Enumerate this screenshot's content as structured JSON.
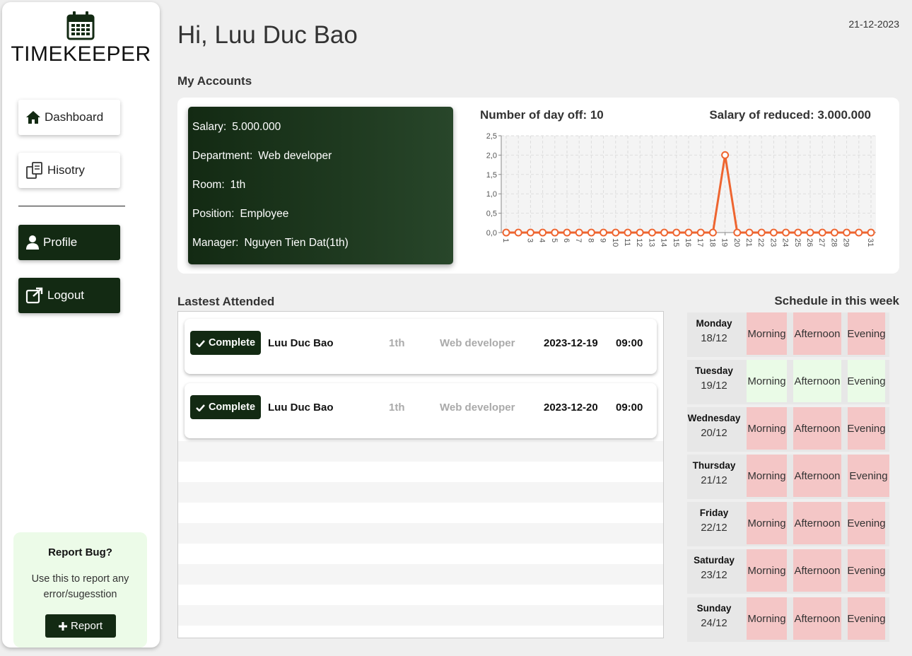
{
  "brand": {
    "title": "TIMEKEEPER",
    "icon": "calendar-icon"
  },
  "nav": {
    "dashboard": "Dashboard",
    "history": "Hisotry",
    "profile": "Profile",
    "logout": "Logout"
  },
  "report": {
    "title": "Report Bug?",
    "description": "Use this to report any error/sugesstion",
    "button": "Report"
  },
  "header": {
    "greeting": "Hi, Luu Duc Bao",
    "date": "21-12-2023"
  },
  "accounts": {
    "section_title": "My Accounts",
    "fields": [
      {
        "label": "Salary:",
        "value": "5.000.000"
      },
      {
        "label": "Department:",
        "value": "Web developer"
      },
      {
        "label": "Room:",
        "value": "1th"
      },
      {
        "label": "Position:",
        "value": "Employee"
      },
      {
        "label": "Manager:",
        "value": "Nguyen Tien Dat(1th)"
      }
    ],
    "day_off": "Number of day off: 10",
    "salary_reduced": "Salary of reduced: 3.000.000"
  },
  "chart_data": {
    "type": "line",
    "x": [
      1,
      2,
      3,
      4,
      5,
      6,
      7,
      8,
      9,
      10,
      11,
      12,
      13,
      14,
      15,
      16,
      17,
      18,
      19,
      20,
      21,
      22,
      23,
      24,
      25,
      26,
      27,
      28,
      29,
      30,
      31
    ],
    "x_tick_labels": [
      "1",
      "3",
      "4",
      "5",
      "6",
      "7",
      "8",
      "9",
      "10",
      "11",
      "12",
      "13",
      "14",
      "15",
      "16",
      "17",
      "18",
      "19",
      "20",
      "21",
      "22",
      "23",
      "24",
      "25",
      "26",
      "27",
      "28",
      "29",
      "31"
    ],
    "series": [
      {
        "values": [
          0,
          0,
          0,
          0,
          0,
          0,
          0,
          0,
          0,
          0,
          0,
          0,
          0,
          0,
          0,
          0,
          0,
          0,
          2,
          0,
          0,
          0,
          0,
          0,
          0,
          0,
          0,
          0,
          0,
          0,
          0
        ],
        "color": "#ee6530"
      }
    ],
    "y_ticks": [
      "0,0",
      "0,5",
      "1,0",
      "1,5",
      "2,0",
      "2,5"
    ],
    "ylim": [
      0,
      2.5
    ],
    "grid": true
  },
  "attended": {
    "section_title": "Lastest Attended",
    "rows": [
      {
        "status": "Complete",
        "name": "Luu Duc Bao",
        "room": "1th",
        "department": "Web developer",
        "date": "2023-12-19",
        "time": "09:00"
      },
      {
        "status": "Complete",
        "name": "Luu Duc Bao",
        "room": "1th",
        "department": "Web developer",
        "date": "2023-12-20",
        "time": "09:00"
      }
    ]
  },
  "schedule": {
    "title": "Schedule in this week",
    "days": [
      {
        "name": "Monday",
        "date": "18/12",
        "slots": [
          "Morning",
          "Afternoon",
          "Evening"
        ],
        "state": "off"
      },
      {
        "name": "Tuesday",
        "date": "19/12",
        "slots": [
          "Morning",
          "Afternoon",
          "Evening"
        ],
        "state": "on"
      },
      {
        "name": "Wednesday",
        "date": "20/12",
        "slots": [
          "Morning",
          "Afternoon",
          "Evening"
        ],
        "state": "off"
      },
      {
        "name": "Thursday",
        "date": "21/12",
        "slots": [
          "Morning",
          "Afternoon",
          "Evening"
        ],
        "state": "off"
      },
      {
        "name": "Friday",
        "date": "22/12",
        "slots": [
          "Morning",
          "Afternoon",
          "Evening"
        ],
        "state": "off"
      },
      {
        "name": "Saturday",
        "date": "23/12",
        "slots": [
          "Morning",
          "Afternoon",
          "Evening"
        ],
        "state": "off"
      },
      {
        "name": "Sunday",
        "date": "24/12",
        "slots": [
          "Morning",
          "Afternoon",
          "Evening"
        ],
        "state": "off"
      }
    ],
    "colors": {
      "off": "#f4c6c6",
      "on": "#eafbe7"
    }
  },
  "colors": {
    "accent": "#132a13",
    "chart_line": "#ee6530"
  }
}
